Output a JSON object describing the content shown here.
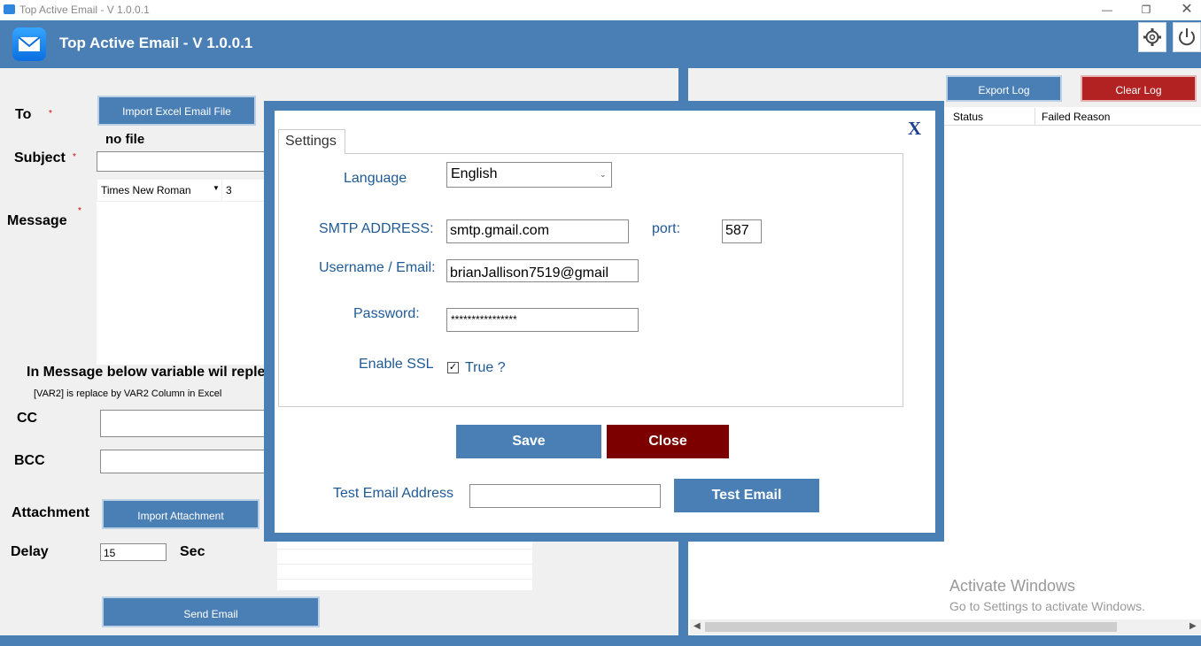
{
  "window": {
    "title": "Top Active Email - V 1.0.0.1"
  },
  "header": {
    "title": "Top Active Email - V 1.0.0.1"
  },
  "form": {
    "to_label": "To",
    "import_excel_label": "Import Excel Email File",
    "no_file_text": "no file",
    "subject_label": "Subject",
    "font_family": "Times New Roman",
    "font_size": "3",
    "message_label": "Message",
    "variable_heading": "In Message below variable wil reple",
    "variable_note": "[VAR2] is replace by VAR2 Column in Excel",
    "cc_label": "CC",
    "bcc_label": "BCC",
    "attachment_label": "Attachment",
    "import_attachment_label": "Import Attachment",
    "delay_label": "Delay",
    "delay_value": "15",
    "delay_unit": "Sec",
    "send_email_label": "Send Email"
  },
  "log": {
    "export_label": "Export Log",
    "clear_label": "Clear Log",
    "columns": [
      "Status",
      "Failed Reason"
    ]
  },
  "settings": {
    "close_x": "X",
    "tab_label": "Settings",
    "language_label": "Language",
    "language_value": "English",
    "smtp_label": "SMTP ADDRESS:",
    "smtp_value": "smtp.gmail.com",
    "port_label": "port:",
    "port_value": "587",
    "username_label": "Username / Email:",
    "username_value": "brianJallison7519@gmail",
    "password_label": "Password:",
    "password_value": "****************",
    "ssl_label": "Enable SSL",
    "ssl_checkbox_label": "True ?",
    "save_label": "Save",
    "close_label": "Close",
    "test_address_label": "Test Email Address",
    "test_email_label": "Test Email"
  },
  "watermark": {
    "title": "Activate Windows",
    "subtitle": "Go to Settings to activate Windows."
  },
  "colors": {
    "brand": "#4a7fb5",
    "danger": "#b22222",
    "close": "#7d0000"
  }
}
